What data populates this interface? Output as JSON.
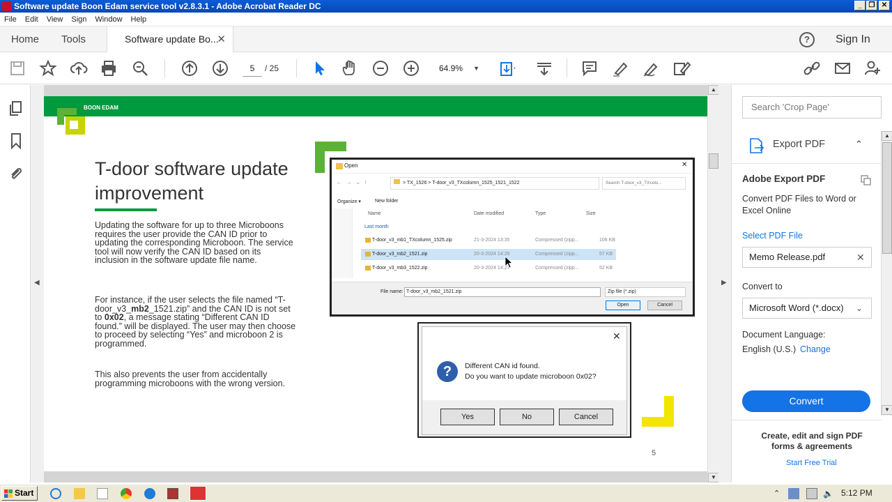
{
  "window": {
    "title": "Software update Boon Edam service tool v2.8.3.1 - Adobe Acrobat Reader DC",
    "controls": [
      "_",
      "❐",
      "✕"
    ]
  },
  "menu": [
    "File",
    "Edit",
    "View",
    "Sign",
    "Window",
    "Help"
  ],
  "tabs": {
    "home": "Home",
    "tools": "Tools",
    "active": "Software update Bo...",
    "close": "✕"
  },
  "header": {
    "help": "?",
    "sign_in": "Sign In"
  },
  "toolbar": {
    "page_current": "5",
    "page_total": "/ 25",
    "zoom": "64.9%"
  },
  "document": {
    "logo_text": "BOON EDAM",
    "title": "T-door software update improvement",
    "para1": "Updating the software for up to three Microboons requires the user provide the CAN ID prior to updating the corresponding Microboon. The service tool will now verify the CAN ID based on its inclusion in the software update file name.",
    "para2_a": "For instance, if the user selects the file named “T-door_v3_",
    "para2_b": "mb2",
    "para2_c": "_1521.zip” and the CAN ID is not set to ",
    "para2_d": "0x02",
    "para2_e": ", a message stating “Different CAN ID found.” will be displayed. The user may then choose to proceed by selecting “Yes” and microboon 2 is programmed.",
    "para3": "This also prevents the user from accidentally programming microboons with the wrong version.",
    "page_number": "5",
    "open_dialog": {
      "title": "Open",
      "path_a": "TX_1526",
      "path_sep": ">",
      "path_b": "T-door_v3_TXcolumn_1525_1521_1522",
      "search": "Search T-door_v3_TXcolu...",
      "organize": "Organize ▾",
      "new_folder": "New folder",
      "col_name": "Name",
      "col_date": "Date modified",
      "col_type": "Type",
      "col_size": "Size",
      "group": "Last month",
      "files": [
        {
          "name": "T-door_v3_mb1_TXcolumn_1525.zip",
          "date": "21-3-2024 13:35",
          "type": "Compressed (zipp...",
          "size": "106 KB"
        },
        {
          "name": "T-door_v3_mb2_1521.zip",
          "date": "20-3-2024 14:26",
          "type": "Compressed (zipp...",
          "size": "57 KB"
        },
        {
          "name": "T-door_v3_mb3_1522.zip",
          "date": "20-3-2024 14:27",
          "type": "Compressed (zipp...",
          "size": "52 KB"
        }
      ],
      "filename_label": "File name:",
      "filename_value": "T-door_v3_mb2_1521.zip",
      "filter": "Zip file (*.zip)",
      "open_btn": "Open",
      "cancel_btn": "Cancel"
    },
    "msg_dialog": {
      "line1": "Different CAN id found.",
      "line2": "Do you want to update microboon 0x02?",
      "yes": "Yes",
      "no": "No",
      "cancel": "Cancel"
    }
  },
  "right_panel": {
    "search_placeholder": "Search 'Crop Page'",
    "export_title": "Export PDF",
    "adobe_export": "Adobe Export PDF",
    "desc": "Convert PDF Files to Word or Excel Online",
    "select_pdf": "Select PDF File",
    "file": "Memo Release.pdf",
    "convert_to": "Convert to",
    "format": "Microsoft Word (*.docx)",
    "doc_lang": "Document Language:",
    "lang": "English (U.S.)",
    "change": "Change",
    "convert": "Convert",
    "promo": "Create, edit and sign PDF forms & agreements",
    "trial": "Start Free Trial"
  },
  "taskbar": {
    "start": "Start",
    "clock": "5:12 PM"
  },
  "colors": {
    "accent": "#1473e6",
    "brand_green": "#009a3e",
    "logo_yellow": "#c8d400"
  }
}
